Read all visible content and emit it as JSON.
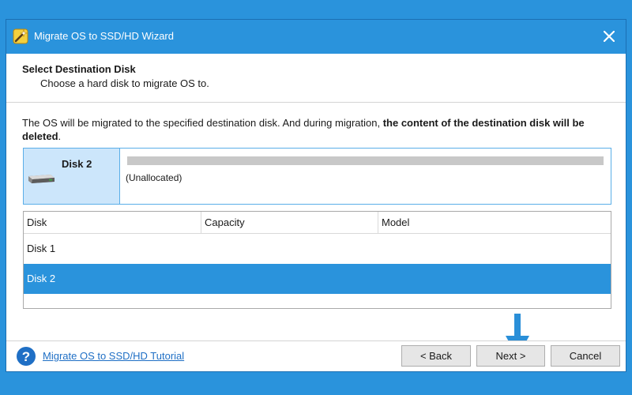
{
  "window": {
    "title": "Migrate OS to SSD/HD Wizard"
  },
  "header": {
    "title": "Select Destination Disk",
    "subtitle": "Choose a hard disk to migrate OS to."
  },
  "warning": {
    "text_plain": "The OS will be migrated to the specified destination disk. And during migration, ",
    "text_bold": "the content of the destination disk will be deleted",
    "text_end": "."
  },
  "selected_disk": {
    "name": "Disk 2",
    "partition_label": "(Unallocated)",
    "bar_color": "#c8c8c8"
  },
  "disk_table": {
    "columns": [
      "Disk",
      "Capacity",
      "Model"
    ],
    "rows": [
      {
        "disk": "Disk 1",
        "capacity": "",
        "model": "",
        "selected": false
      },
      {
        "disk": "Disk 2",
        "capacity": "",
        "model": "",
        "selected": true
      }
    ]
  },
  "footer": {
    "tutorial_link": "Migrate OS to SSD/HD Tutorial",
    "back_label": "< Back",
    "next_label": "Next >",
    "cancel_label": "Cancel"
  },
  "colors": {
    "accent": "#2a93dc",
    "selected_row": "#2a93dc",
    "arrow": "#2a8fd8"
  },
  "icons": {
    "app": "wizard-wand-icon",
    "close": "close-icon",
    "disk": "hard-disk-icon",
    "help": "help-icon",
    "arrow": "arrow-down-icon"
  }
}
